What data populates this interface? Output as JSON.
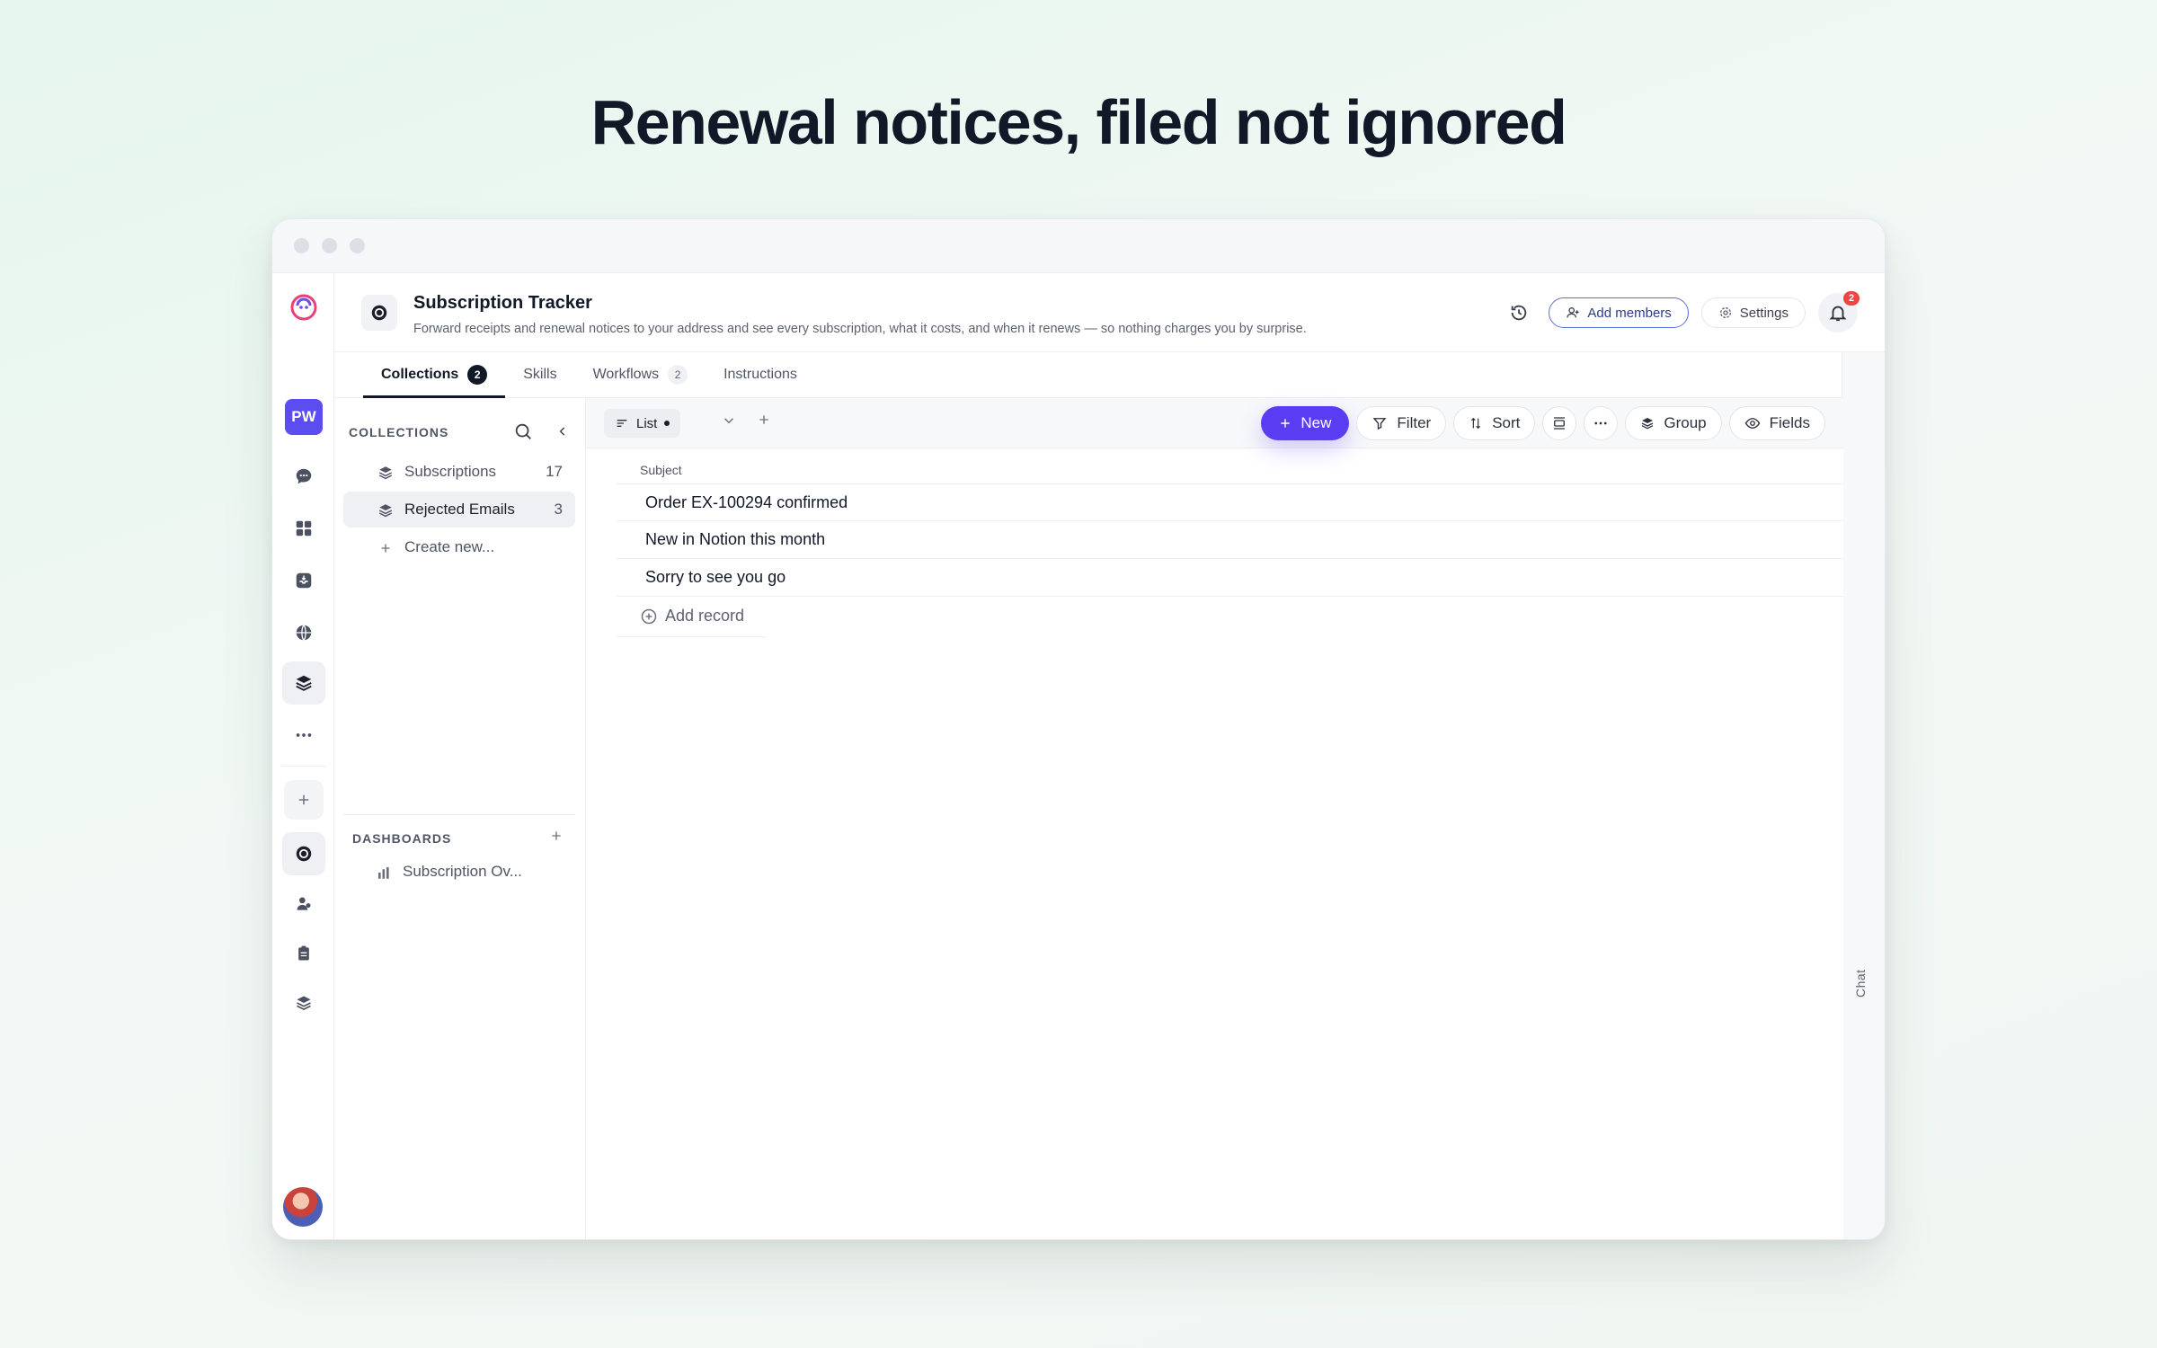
{
  "headline": "Renewal notices, filed not ignored",
  "header": {
    "title": "Subscription Tracker",
    "description": "Forward receipts and renewal notices to your address and see every subscription, what it costs, and when it renews — so nothing charges you by surprise.",
    "add_members": "Add members",
    "settings": "Settings",
    "notifications_count": "2"
  },
  "rail": {
    "workspace_initials": "PW"
  },
  "tabs": [
    {
      "label": "Collections",
      "count": "2"
    },
    {
      "label": "Skills"
    },
    {
      "label": "Workflows",
      "count": "2"
    },
    {
      "label": "Instructions"
    }
  ],
  "sidebar": {
    "collections_heading": "COLLECTIONS",
    "items": [
      {
        "label": "Subscriptions",
        "count": "17"
      },
      {
        "label": "Rejected Emails",
        "count": "3"
      }
    ],
    "create_new": "Create new...",
    "dashboards_heading": "DASHBOARDS",
    "dashboards": [
      {
        "label": "Subscription Ov..."
      }
    ]
  },
  "toolbar": {
    "view_label": "List",
    "new": "New",
    "filter": "Filter",
    "sort": "Sort",
    "group": "Group",
    "fields": "Fields"
  },
  "table": {
    "column": "Subject",
    "rows": [
      "Order EX-100294 confirmed",
      "New in Notion this month",
      "Sorry to see you go"
    ],
    "add_record": "Add record"
  },
  "chat_panel": {
    "label": "Chat"
  },
  "colors": {
    "accent": "#5a3df2",
    "badge": "#ef4444",
    "workspace": "#5b4df0"
  }
}
